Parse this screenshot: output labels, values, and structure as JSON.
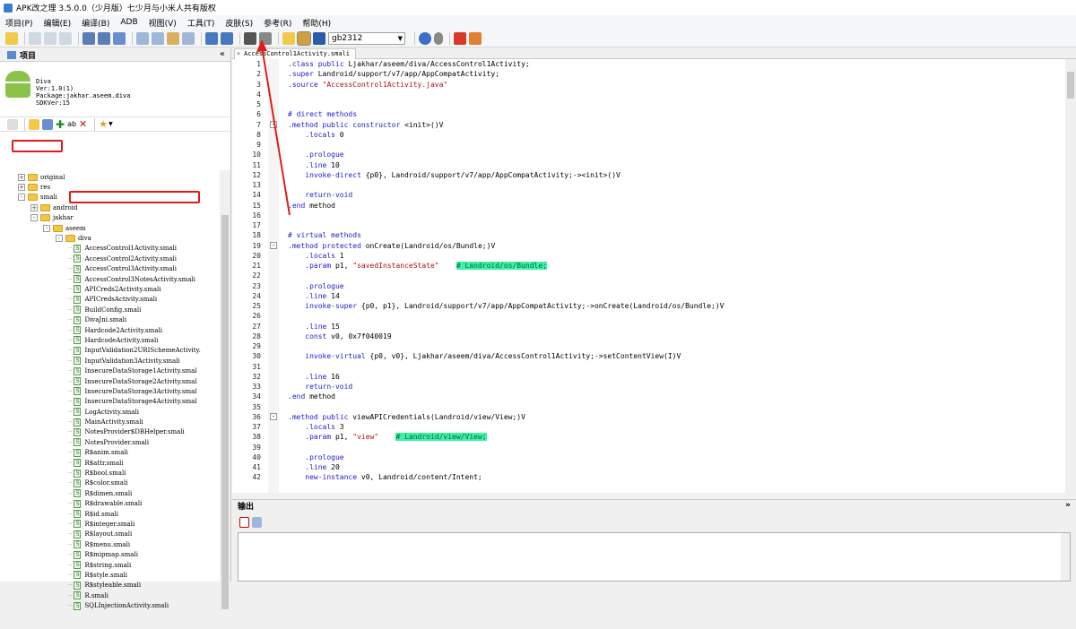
{
  "window": {
    "title": "APK改之理 3.5.0.0（少月版）七少月与小米人共有版权"
  },
  "menu": [
    "项目(P)",
    "编辑(E)",
    "编译(B)",
    "ADB",
    "视图(V)",
    "工具(T)",
    "皮肤(S)",
    "参考(R)",
    "帮助(H)"
  ],
  "toolbar": {
    "encoding": "gb2312"
  },
  "project_panel": {
    "title": "项目",
    "app": {
      "name": "Diva",
      "version": "Ver:1.0(1)",
      "package": "Package:jakhar.aseem.diva",
      "sdk": "SDKVer:15"
    }
  },
  "tree": [
    {
      "label": "original",
      "type": "folder",
      "indent": 1,
      "exp": "+"
    },
    {
      "label": "res",
      "type": "folder",
      "indent": 1,
      "exp": "+"
    },
    {
      "label": "smali",
      "type": "folder",
      "indent": 1,
      "exp": "-"
    },
    {
      "label": "android",
      "type": "folder",
      "indent": 2,
      "exp": "+"
    },
    {
      "label": "jakhar",
      "type": "folder",
      "indent": 2,
      "exp": "-"
    },
    {
      "label": "aseem",
      "type": "folder",
      "indent": 3,
      "exp": "-"
    },
    {
      "label": "diva",
      "type": "folder",
      "indent": 4,
      "exp": "-"
    },
    {
      "label": "AccessControl1Activity.smali",
      "type": "file",
      "indent": 5
    },
    {
      "label": "AccessControl2Activity.smali",
      "type": "file",
      "indent": 5
    },
    {
      "label": "AccessControl3Activity.smali",
      "type": "file",
      "indent": 5
    },
    {
      "label": "AccessControl3NotesActivity.smali",
      "type": "file",
      "indent": 5
    },
    {
      "label": "APICreds2Activity.smali",
      "type": "file",
      "indent": 5
    },
    {
      "label": "APICredsActivity.smali",
      "type": "file",
      "indent": 5
    },
    {
      "label": "BuildConfig.smali",
      "type": "file",
      "indent": 5
    },
    {
      "label": "DivaJni.smali",
      "type": "file",
      "indent": 5
    },
    {
      "label": "Hardcode2Activity.smali",
      "type": "file",
      "indent": 5
    },
    {
      "label": "HardcodeActivity.smali",
      "type": "file",
      "indent": 5
    },
    {
      "label": "InputValidation2URISchemeActivity.",
      "type": "file",
      "indent": 5
    },
    {
      "label": "InputValidation3Activity.smali",
      "type": "file",
      "indent": 5
    },
    {
      "label": "InsecureDataStorage1Activity.smal",
      "type": "file",
      "indent": 5
    },
    {
      "label": "InsecureDataStorage2Activity.smal",
      "type": "file",
      "indent": 5
    },
    {
      "label": "InsecureDataStorage3Activity.smal",
      "type": "file",
      "indent": 5
    },
    {
      "label": "InsecureDataStorage4Activity.smal",
      "type": "file",
      "indent": 5
    },
    {
      "label": "LogActivity.smali",
      "type": "file",
      "indent": 5
    },
    {
      "label": "MainActivity.smali",
      "type": "file",
      "indent": 5
    },
    {
      "label": "NotesProvider$DBHelper.smali",
      "type": "file",
      "indent": 5
    },
    {
      "label": "NotesProvider.smali",
      "type": "file",
      "indent": 5
    },
    {
      "label": "R$anim.smali",
      "type": "file",
      "indent": 5
    },
    {
      "label": "R$attr.smali",
      "type": "file",
      "indent": 5
    },
    {
      "label": "R$bool.smali",
      "type": "file",
      "indent": 5
    },
    {
      "label": "R$color.smali",
      "type": "file",
      "indent": 5
    },
    {
      "label": "R$dimen.smali",
      "type": "file",
      "indent": 5
    },
    {
      "label": "R$drawable.smali",
      "type": "file",
      "indent": 5
    },
    {
      "label": "R$id.smali",
      "type": "file",
      "indent": 5
    },
    {
      "label": "R$integer.smali",
      "type": "file",
      "indent": 5
    },
    {
      "label": "R$layout.smali",
      "type": "file",
      "indent": 5
    },
    {
      "label": "R$menu.smali",
      "type": "file",
      "indent": 5
    },
    {
      "label": "R$mipmap.smali",
      "type": "file",
      "indent": 5
    },
    {
      "label": "R$string.smali",
      "type": "file",
      "indent": 5
    },
    {
      "label": "R$style.smali",
      "type": "file",
      "indent": 5
    },
    {
      "label": "R$styleable.smali",
      "type": "file",
      "indent": 5
    },
    {
      "label": "R.smali",
      "type": "file",
      "indent": 5
    },
    {
      "label": "SQLInjectionActivity.smali",
      "type": "file",
      "indent": 5
    }
  ],
  "editor": {
    "tab": "AccessControl1Activity.smali",
    "lines": [
      ".class public Ljakhar/aseem/diva/AccessControl1Activity;",
      ".super Landroid/support/v7/app/AppCompatActivity;",
      ".source \"AccessControl1Activity.java\"",
      "",
      "",
      "# direct methods",
      ".method public constructor <init>()V",
      "    .locals 0",
      "",
      "    .prologue",
      "    .line 10",
      "    invoke-direct {p0}, Landroid/support/v7/app/AppCompatActivity;-><init>()V",
      "",
      "    return-void",
      ".end method",
      "",
      "",
      "# virtual methods",
      ".method protected onCreate(Landroid/os/Bundle;)V",
      "    .locals 1",
      "    .param p1, \"savedInstanceState\"    # Landroid/os/Bundle;",
      "",
      "    .prologue",
      "    .line 14",
      "    invoke-super {p0, p1}, Landroid/support/v7/app/AppCompatActivity;->onCreate(Landroid/os/Bundle;)V",
      "",
      "    .line 15",
      "    const v0, 0x7f040019",
      "",
      "    invoke-virtual {p0, v0}, Ljakhar/aseem/diva/AccessControl1Activity;->setContentView(I)V",
      "",
      "    .line 16",
      "    return-void",
      ".end method",
      "",
      ".method public viewAPICredentials(Landroid/view/View;)V",
      "    .locals 3",
      "    .param p1, \"view\"    # Landroid/view/View;",
      "",
      "    .prologue",
      "    .line 20",
      "    new-instance v0, Landroid/content/Intent;"
    ]
  },
  "output_panel": {
    "title": "输出"
  },
  "colors": {
    "highlight": "#3ef0a8",
    "annotation": "#e01b1b",
    "keyword": "#2020d0",
    "string": "#b01010"
  }
}
